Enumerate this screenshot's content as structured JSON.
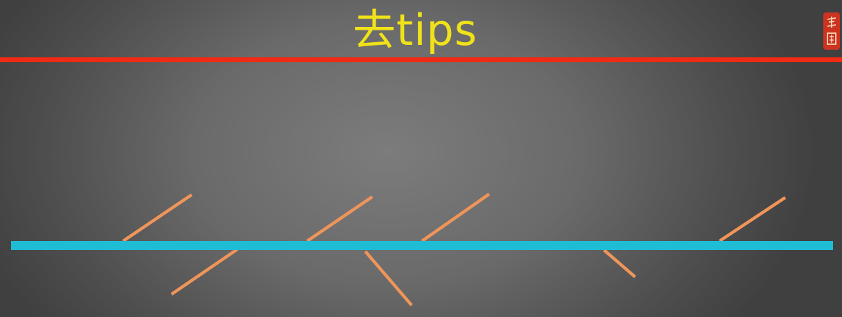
{
  "slide": {
    "title": "去tips"
  },
  "seal": {
    "text": "墨图",
    "color": "#d8321e"
  },
  "colors": {
    "title": "#f0e21a",
    "title_rule": "#f02a14",
    "main_line": "#1fbcd6",
    "segments": "#f0955a"
  }
}
